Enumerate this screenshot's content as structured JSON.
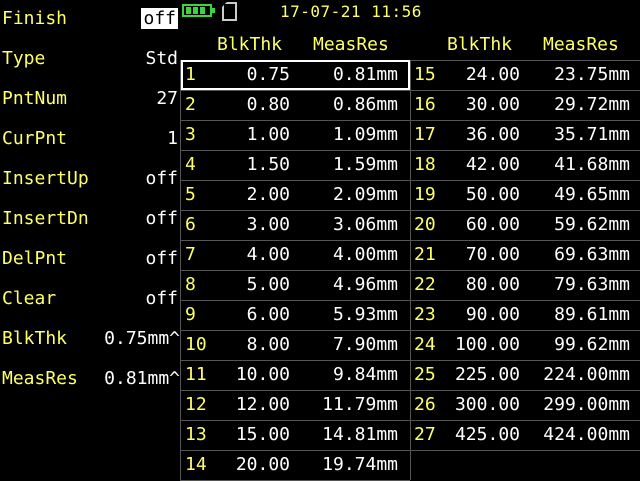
{
  "menu": [
    {
      "label": "Finish",
      "value": "off",
      "selected": true
    },
    {
      "label": "Type",
      "value": "Std"
    },
    {
      "label": "PntNum",
      "value": "27"
    },
    {
      "label": "CurPnt",
      "value": "1"
    },
    {
      "label": "InsertUp",
      "value": "off"
    },
    {
      "label": "InsertDn",
      "value": "off"
    },
    {
      "label": "DelPnt",
      "value": "off"
    },
    {
      "label": "Clear",
      "value": "off"
    },
    {
      "label": "BlkThk",
      "value": "0.75mm^"
    },
    {
      "label": "MeasRes",
      "value": "0.81mm^"
    }
  ],
  "status": {
    "datetime": "17-07-21 11:56",
    "battery_level": 1.0,
    "battery_icon": "battery-icon",
    "storage_icon": "sd-card-icon",
    "accent_color": "#3bd63b"
  },
  "table": {
    "headers": {
      "blk_thk": "BlkThk",
      "meas_res": "MeasRes"
    },
    "selected_index": 1,
    "rows": [
      {
        "idx": "1",
        "thk": "0.75",
        "res": "0.81mm"
      },
      {
        "idx": "2",
        "thk": "0.80",
        "res": "0.86mm"
      },
      {
        "idx": "3",
        "thk": "1.00",
        "res": "1.09mm"
      },
      {
        "idx": "4",
        "thk": "1.50",
        "res": "1.59mm"
      },
      {
        "idx": "5",
        "thk": "2.00",
        "res": "2.09mm"
      },
      {
        "idx": "6",
        "thk": "3.00",
        "res": "3.06mm"
      },
      {
        "idx": "7",
        "thk": "4.00",
        "res": "4.00mm"
      },
      {
        "idx": "8",
        "thk": "5.00",
        "res": "4.96mm"
      },
      {
        "idx": "9",
        "thk": "6.00",
        "res": "5.93mm"
      },
      {
        "idx": "10",
        "thk": "8.00",
        "res": "7.90mm"
      },
      {
        "idx": "11",
        "thk": "10.00",
        "res": "9.84mm"
      },
      {
        "idx": "12",
        "thk": "12.00",
        "res": "11.79mm"
      },
      {
        "idx": "13",
        "thk": "15.00",
        "res": "14.81mm"
      },
      {
        "idx": "14",
        "thk": "20.00",
        "res": "19.74mm"
      },
      {
        "idx": "15",
        "thk": "24.00",
        "res": "23.75mm"
      },
      {
        "idx": "16",
        "thk": "30.00",
        "res": "29.72mm"
      },
      {
        "idx": "17",
        "thk": "36.00",
        "res": "35.71mm"
      },
      {
        "idx": "18",
        "thk": "42.00",
        "res": "41.68mm"
      },
      {
        "idx": "19",
        "thk": "50.00",
        "res": "49.65mm"
      },
      {
        "idx": "20",
        "thk": "60.00",
        "res": "59.62mm"
      },
      {
        "idx": "21",
        "thk": "70.00",
        "res": "69.63mm"
      },
      {
        "idx": "22",
        "thk": "80.00",
        "res": "79.63mm"
      },
      {
        "idx": "23",
        "thk": "90.00",
        "res": "89.61mm"
      },
      {
        "idx": "24",
        "thk": "100.00",
        "res": "99.62mm"
      },
      {
        "idx": "25",
        "thk": "225.00",
        "res": "224.00mm"
      },
      {
        "idx": "26",
        "thk": "300.00",
        "res": "299.00mm"
      },
      {
        "idx": "27",
        "thk": "425.00",
        "res": "424.00mm"
      }
    ]
  }
}
